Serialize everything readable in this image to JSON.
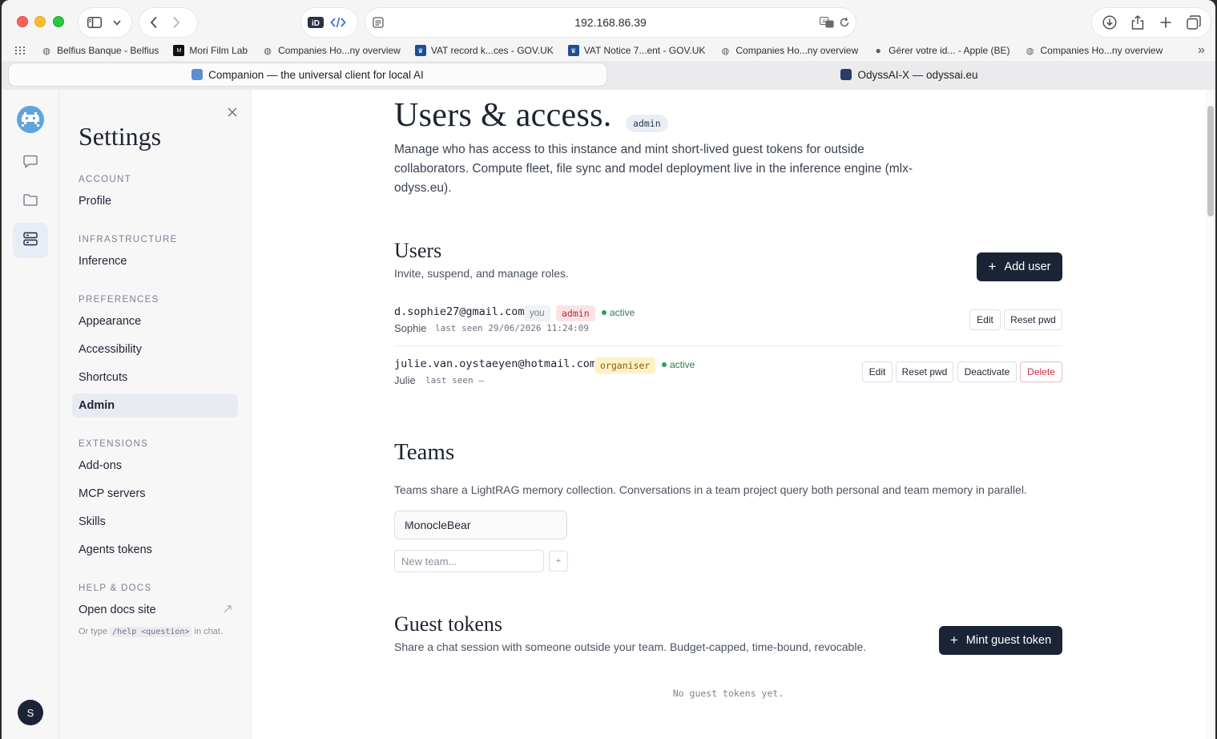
{
  "browser": {
    "url": "192.168.86.39",
    "bookmarks": [
      {
        "label": "Belfius Banque - Belfius",
        "icon": "globe-icon"
      },
      {
        "label": "Mori Film Lab",
        "icon": "mori-logo-icon"
      },
      {
        "label": "Companies Ho...ny overview",
        "icon": "globe-icon"
      },
      {
        "label": "VAT record k...ces - GOV.UK",
        "icon": "crown-icon"
      },
      {
        "label": "VAT Notice 7...ent - GOV.UK",
        "icon": "crown-icon"
      },
      {
        "label": "Companies Ho...ny overview",
        "icon": "globe-icon"
      },
      {
        "label": "Gérer votre id... - Apple (BE)",
        "icon": "apple-icon"
      },
      {
        "label": "Companies Ho...ny overview",
        "icon": "globe-icon"
      }
    ],
    "tabs": [
      {
        "label": "Companion — the universal client for local AI",
        "active": true
      },
      {
        "label": "OdyssAI-X — odyssai.eu",
        "active": false
      }
    ]
  },
  "rail": {
    "avatar_initial": "S"
  },
  "settings": {
    "title": "Settings",
    "sections": [
      {
        "label": "ACCOUNT",
        "items": [
          "Profile"
        ]
      },
      {
        "label": "INFRASTRUCTURE",
        "items": [
          "Inference"
        ]
      },
      {
        "label": "PREFERENCES",
        "items": [
          "Appearance",
          "Accessibility",
          "Shortcuts",
          "Admin"
        ]
      },
      {
        "label": "EXTENSIONS",
        "items": [
          "Add-ons",
          "MCP servers",
          "Skills",
          "Agents tokens"
        ]
      },
      {
        "label": "HELP & DOCS",
        "items": [
          "Open docs site"
        ]
      }
    ],
    "active_item": "Admin",
    "help_hint_prefix": "Or type",
    "help_hint_code": "/help <question>",
    "help_hint_suffix": "in chat."
  },
  "page": {
    "title": "Users & access.",
    "badge": "admin",
    "intro": "Manage who has access to this instance and mint short-lived guest tokens for outside collaborators. Compute fleet, file sync and model deployment live in the inference engine (mlx-odyss.eu).",
    "users": {
      "title": "Users",
      "subtitle": "Invite, suspend, and manage roles.",
      "add_label": "Add user",
      "rows": [
        {
          "email": "d.sophie27@gmail.com",
          "you": "you",
          "role": "admin",
          "status": "active",
          "name": "Sophie",
          "last_seen": "last seen 29/06/2026 11:24:09",
          "actions": [
            "Edit",
            "Reset pwd"
          ]
        },
        {
          "email": "julie.van.oystaeyen@hotmail.com",
          "role": "organiser",
          "status": "active",
          "name": "Julie",
          "last_seen": "last seen —",
          "actions": [
            "Edit",
            "Reset pwd",
            "Deactivate",
            "Delete"
          ]
        }
      ]
    },
    "teams": {
      "title": "Teams",
      "description": "Teams share a LightRAG memory collection. Conversations in a team project query both personal and team memory in parallel.",
      "items": [
        "MonocleBear"
      ],
      "new_placeholder": "New team...",
      "add_symbol": "+"
    },
    "guest_tokens": {
      "title": "Guest tokens",
      "subtitle": "Share a chat session with someone outside your team. Budget-capped, time-bound, revocable.",
      "mint_label": "Mint guest token",
      "empty": "No guest tokens yet."
    }
  },
  "colors": {
    "primary_dark": "#1b2437",
    "danger": "#c62d3f",
    "success": "#2e9e5b",
    "admin_tag_bg": "#fbe3e5",
    "organiser_tag_bg": "#fdf2c7"
  }
}
